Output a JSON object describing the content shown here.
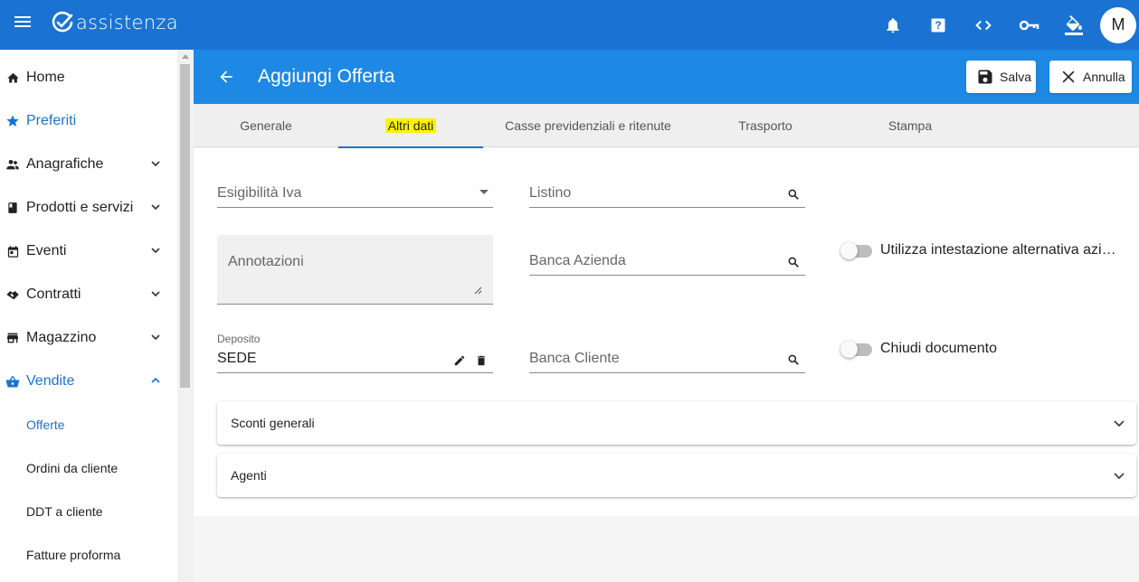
{
  "app": {
    "logo_text": "assistenza",
    "avatar_initial": "M"
  },
  "top_icons": [
    "bell-icon",
    "help-icon",
    "code-icon",
    "key-icon",
    "paint-bucket-icon"
  ],
  "sidebar": {
    "items": [
      {
        "label": "Home",
        "icon": "home-icon"
      },
      {
        "label": "Preferiti",
        "icon": "star-icon"
      },
      {
        "label": "Anagrafiche",
        "icon": "people-icon"
      },
      {
        "label": "Prodotti e servizi",
        "icon": "book-icon"
      },
      {
        "label": "Eventi",
        "icon": "calendar-icon"
      },
      {
        "label": "Contratti",
        "icon": "handshake-icon"
      },
      {
        "label": "Magazzino",
        "icon": "store-icon"
      },
      {
        "label": "Vendite",
        "icon": "basket-icon"
      }
    ],
    "sub_items": [
      {
        "label": "Offerte"
      },
      {
        "label": "Ordini da cliente"
      },
      {
        "label": "DDT a cliente"
      },
      {
        "label": "Fatture proforma"
      }
    ]
  },
  "header": {
    "title": "Aggiungi Offerta",
    "save_label": "Salva",
    "cancel_label": "Annulla"
  },
  "tabs": [
    {
      "label": "Generale"
    },
    {
      "label": "Altri dati"
    },
    {
      "label": "Casse previdenziali e ritenute"
    },
    {
      "label": "Trasporto"
    },
    {
      "label": "Stampa"
    }
  ],
  "form": {
    "esigibilita_iva_label": "Esigibilità Iva",
    "listino_label": "Listino",
    "annotazioni_label": "Annotazioni",
    "banca_azienda_label": "Banca Azienda",
    "deposito_label": "Deposito",
    "deposito_value": "SEDE",
    "banca_cliente_label": "Banca Cliente",
    "toggle_intestazione_label": "Utilizza intestazione alternativa azi…",
    "toggle_chiudi_label": "Chiudi documento"
  },
  "panels": [
    {
      "title": "Sconti generali"
    },
    {
      "title": "Agenti"
    }
  ],
  "colors": {
    "primary": "#1a73d2",
    "header": "#1e88e5",
    "highlight": "#fff200"
  }
}
